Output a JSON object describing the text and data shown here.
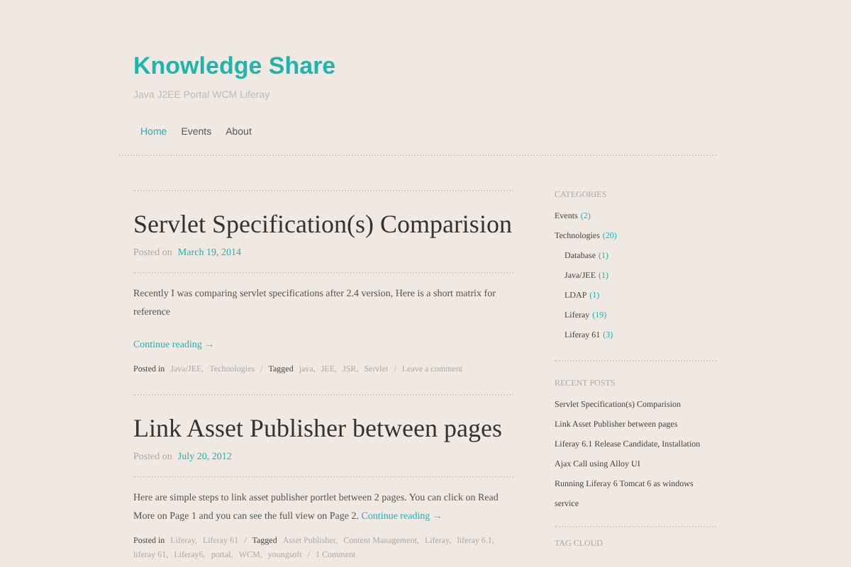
{
  "site": {
    "title": "Knowledge Share",
    "tagline": "Java J2EE Portal WCM Liferay"
  },
  "nav": [
    {
      "label": "Home",
      "selected": true
    },
    {
      "label": "Events",
      "selected": false
    },
    {
      "label": "About",
      "selected": false
    }
  ],
  "posts": [
    {
      "title": "Servlet Specification(s) Comparision",
      "posted_on_label": "Posted on",
      "date": "March 19, 2014",
      "excerpt": "Recently I was comparing servlet specifications after 2.4 version, Here is a short matrix for reference",
      "continue_inline": false,
      "continue": "Continue reading →",
      "posted_in_label": "Posted in",
      "categories": [
        "Java/JEE,",
        "Technologies"
      ],
      "tagged_label": "Tagged",
      "tags": [
        "java,",
        "JEE,",
        "JSR,",
        "Servlet"
      ],
      "separator": "/",
      "comments": "Leave a comment"
    },
    {
      "title": "Link Asset Publisher between pages",
      "posted_on_label": "Posted on",
      "date": "July 20, 2012",
      "excerpt": "Here are simple steps to link asset publisher portlet between 2 pages. You can click on Read More on Page 1 and  you can see the full view on Page 2.",
      "continue_inline": true,
      "continue": "Continue reading →",
      "posted_in_label": "Posted in",
      "categories": [
        "Liferay,",
        "Liferay 61"
      ],
      "tagged_label": "Tagged",
      "tags": [
        "Asset Publisher,",
        "Content Management,",
        "Liferay,",
        "liferay 6.1,",
        "liferay 61,",
        "Liferay6,",
        "portal,",
        "WCM,",
        "youngsoft"
      ],
      "separator": "/",
      "comments": "1 Comment"
    }
  ],
  "sidebar": {
    "categories_heading": "CATEGORIES",
    "categories": [
      {
        "name": "Events",
        "count": "(2)"
      },
      {
        "name": "Technologies",
        "count": "(20)",
        "children": [
          {
            "name": "Database",
            "count": "(1)"
          },
          {
            "name": "Java/JEE",
            "count": "(1)"
          },
          {
            "name": "LDAP",
            "count": "(1)"
          },
          {
            "name": "Liferay",
            "count": "(19)"
          },
          {
            "name": "Liferay 61",
            "count": "(3)"
          }
        ]
      }
    ],
    "recent_heading": "RECENT POSTS",
    "recent_posts": [
      "Servlet Specification(s) Comparision",
      "Link Asset Publisher between pages",
      "Liferay 6.1 Release Candidate, Installation",
      "Ajax Call using Alloy UI",
      "Running Liferay 6 Tomcat 6 as windows service"
    ],
    "tag_cloud_heading": "TAG CLOUD"
  }
}
